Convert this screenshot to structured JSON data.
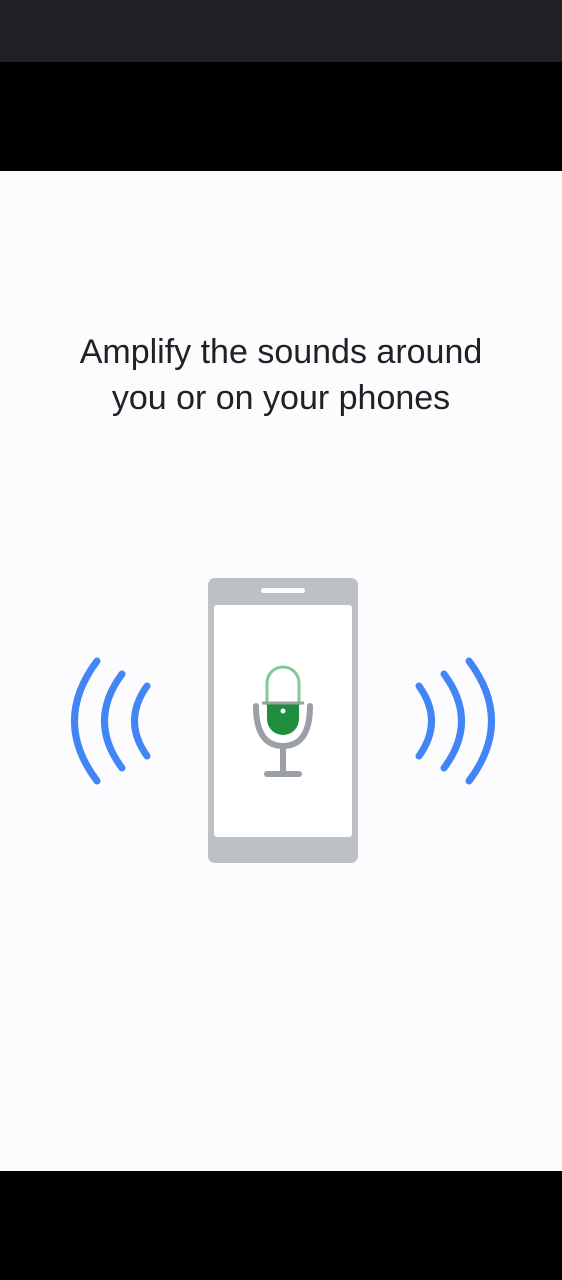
{
  "headline": {
    "line1": "Amplify the sounds around",
    "line2": "you or on your phones"
  },
  "illustration": {
    "icons": [
      "phone-icon",
      "microphone-icon",
      "sound-waves-left-icon",
      "sound-waves-right-icon"
    ],
    "colors": {
      "phone_frame": "#bdc1c6",
      "screen": "#ffffff",
      "mic_green": "#1e8e3e",
      "mic_outline": "#81c995",
      "stand_gray": "#9aa0a6",
      "wave_blue": "#4285f4"
    }
  }
}
